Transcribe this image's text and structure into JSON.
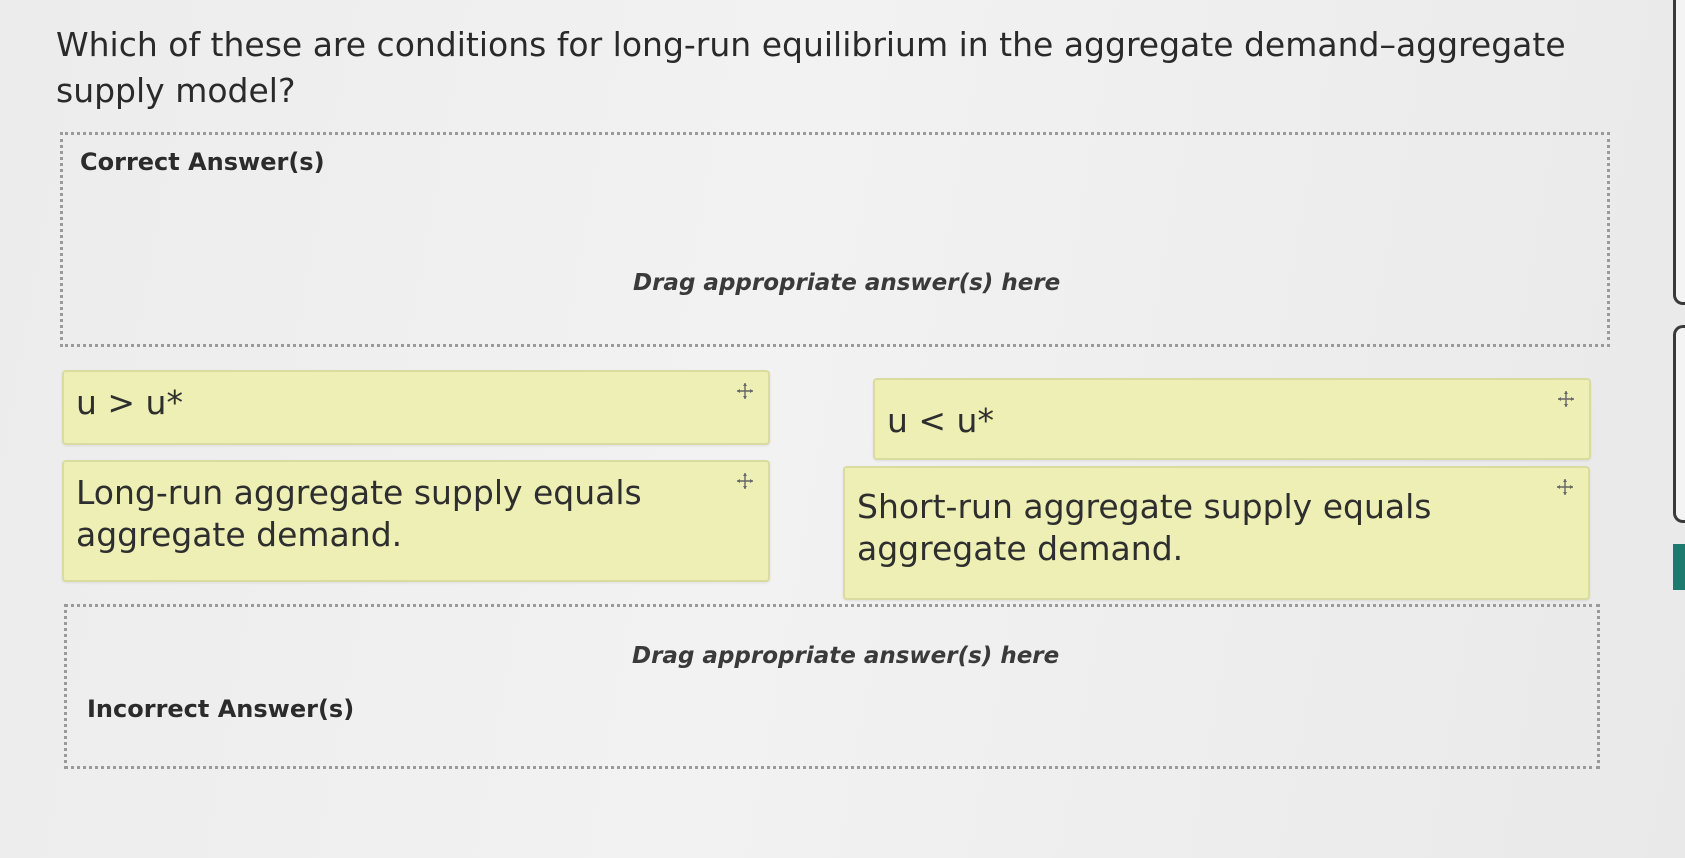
{
  "question": {
    "text": "Which of these are conditions for long-run equilibrium in the aggregate demand–aggregate supply model?"
  },
  "zones": {
    "correct": {
      "title": "Correct Answer(s)",
      "hint": "Drag appropriate answer(s) here"
    },
    "incorrect": {
      "title": "Incorrect Answer(s)",
      "hint": "Drag appropriate answer(s) here"
    }
  },
  "options": [
    {
      "text": "u > u*",
      "icon": "move-icon"
    },
    {
      "text": "u < u*",
      "icon": "move-icon"
    },
    {
      "text": "Long-run aggregate supply equals aggregate demand.",
      "icon": "move-icon"
    },
    {
      "text": "Short-run aggregate supply equals aggregate demand.",
      "icon": "move-icon"
    }
  ],
  "colors": {
    "tile_background": "#edefb4",
    "tile_border": "#d9dba0",
    "side_accent": "#1e7a6e"
  }
}
